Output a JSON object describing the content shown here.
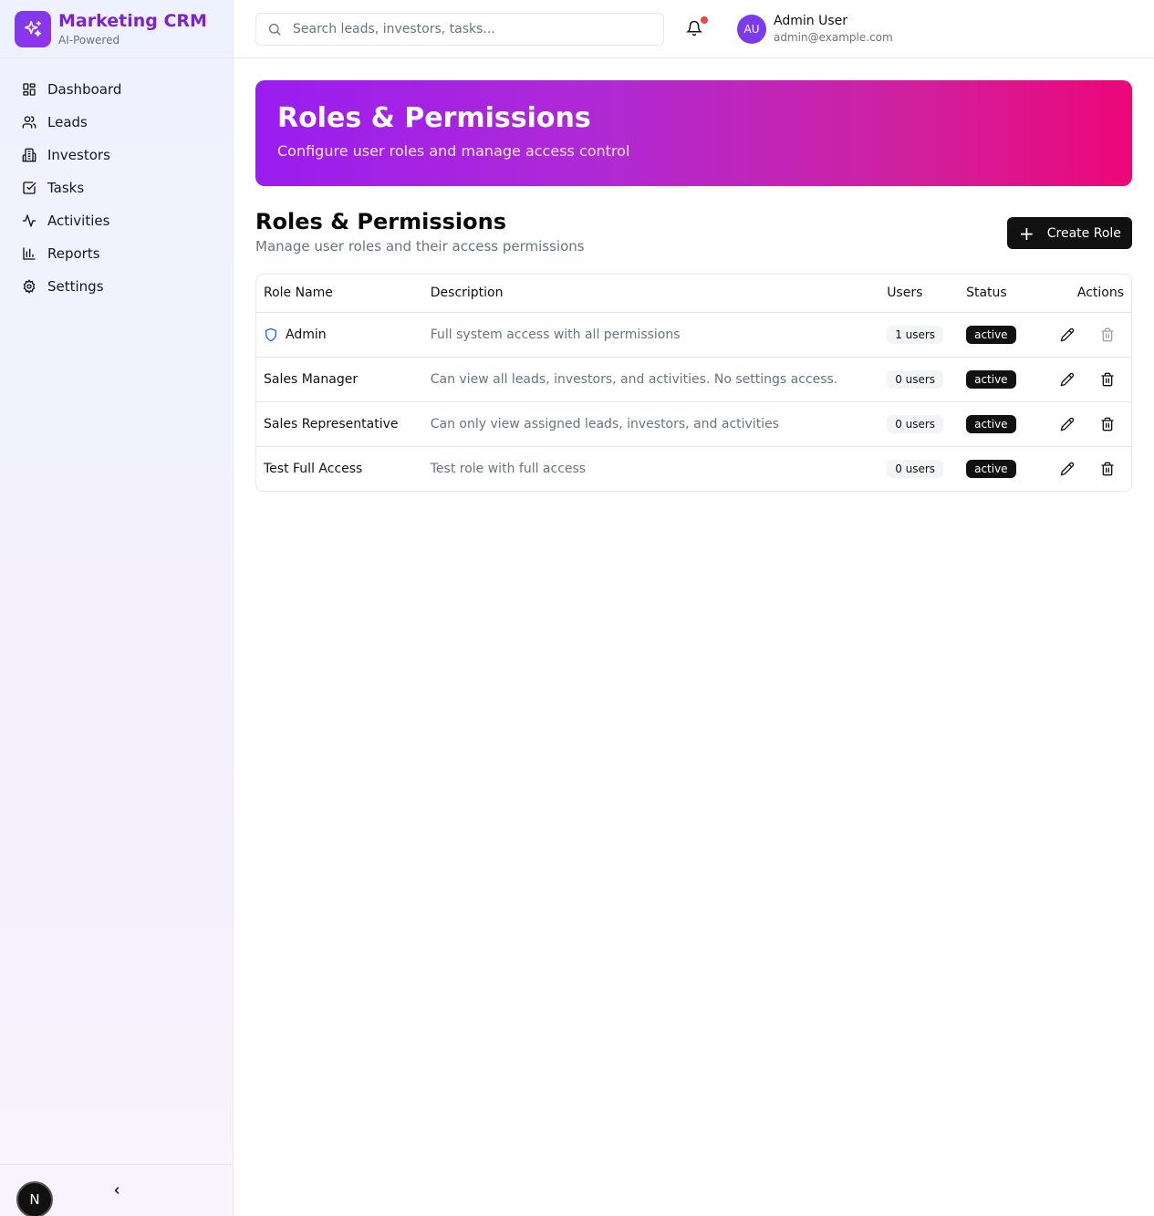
{
  "brand": {
    "title": "Marketing CRM",
    "subtitle": "AI-Powered",
    "accent": "#7c3aed"
  },
  "nav": [
    {
      "label": "Dashboard",
      "icon": "layout-grid-icon"
    },
    {
      "label": "Leads",
      "icon": "users-icon"
    },
    {
      "label": "Investors",
      "icon": "building-icon"
    },
    {
      "label": "Tasks",
      "icon": "check-square-icon"
    },
    {
      "label": "Activities",
      "icon": "activity-icon"
    },
    {
      "label": "Reports",
      "icon": "bar-chart-icon"
    },
    {
      "label": "Settings",
      "icon": "gear-icon"
    }
  ],
  "footer": {
    "badge": "N"
  },
  "header": {
    "search_placeholder": "Search leads, investors, tasks...",
    "user": {
      "initials": "AU",
      "name": "Admin User",
      "email": "admin@example.com"
    }
  },
  "banner": {
    "title": "Roles & Permissions",
    "subtitle": "Configure user roles and manage access control"
  },
  "section": {
    "title": "Roles & Permissions",
    "subtitle": "Manage user roles and their access permissions",
    "create_label": "Create Role"
  },
  "table": {
    "columns": [
      "Role Name",
      "Description",
      "Users",
      "Status",
      "Actions"
    ],
    "rows": [
      {
        "name": "Admin",
        "description": "Full system access with all permissions",
        "users": "1 users",
        "status": "active",
        "system": true
      },
      {
        "name": "Sales Manager",
        "description": "Can view all leads, investors, and activities. No settings access.",
        "users": "0 users",
        "status": "active",
        "system": false
      },
      {
        "name": "Sales Representative",
        "description": "Can only view assigned leads, investors, and activities",
        "users": "0 users",
        "status": "active",
        "system": false
      },
      {
        "name": "Test Full Access",
        "description": "Test role with full access",
        "users": "0 users",
        "status": "active",
        "system": false
      }
    ]
  }
}
